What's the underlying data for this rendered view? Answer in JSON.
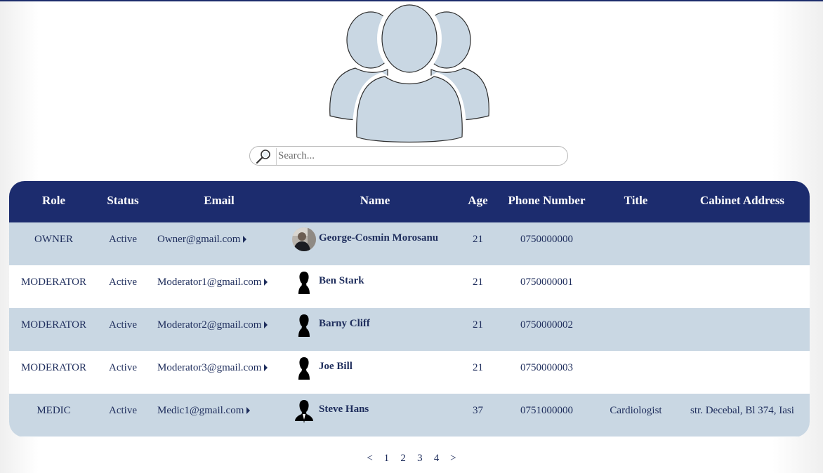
{
  "search": {
    "placeholder": "Search..."
  },
  "table": {
    "headers": [
      "Role",
      "Status",
      "Email",
      "Name",
      "Age",
      "Phone Number",
      "Title",
      "Cabinet Address"
    ],
    "rows": [
      {
        "role": "OWNER",
        "status": "Active",
        "email": "Owner@gmail.com",
        "name": "George-Cosmin Morosanu",
        "age": "21",
        "phone": "0750000000",
        "title": "",
        "address": "",
        "avatar": "photo"
      },
      {
        "role": "MODERATOR",
        "status": "Active",
        "email": "Moderator1@gmail.com",
        "name": "Ben Stark",
        "age": "21",
        "phone": "0750000001",
        "title": "",
        "address": "",
        "avatar": "silhouette"
      },
      {
        "role": "MODERATOR",
        "status": "Active",
        "email": "Moderator2@gmail.com",
        "name": "Barny Cliff",
        "age": "21",
        "phone": "0750000002",
        "title": "",
        "address": "",
        "avatar": "silhouette"
      },
      {
        "role": "MODERATOR",
        "status": "Active",
        "email": "Moderator3@gmail.com",
        "name": "Joe Bill",
        "age": "21",
        "phone": "0750000003",
        "title": "",
        "address": "",
        "avatar": "silhouette"
      },
      {
        "role": "MEDIC",
        "status": "Active",
        "email": "Medic1@gmail.com",
        "name": "Steve Hans",
        "age": "37",
        "phone": "0751000000",
        "title": "Cardiologist",
        "address": "str. Decebal, Bl 374, Iasi",
        "avatar": "silhouette-suit"
      }
    ]
  },
  "pagination": {
    "prev": "<",
    "pages": [
      "1",
      "2",
      "3",
      "4"
    ],
    "next": ">"
  },
  "colors": {
    "header_bg": "#1c2c6e",
    "row_shaded": "#c9d7e3",
    "text": "#1e2d5c",
    "users_icon_fill": "#c9d7e3"
  },
  "icons": {
    "users": "users-group-icon",
    "search": "magnifier-icon",
    "avatar_default": "person-silhouette-icon"
  }
}
